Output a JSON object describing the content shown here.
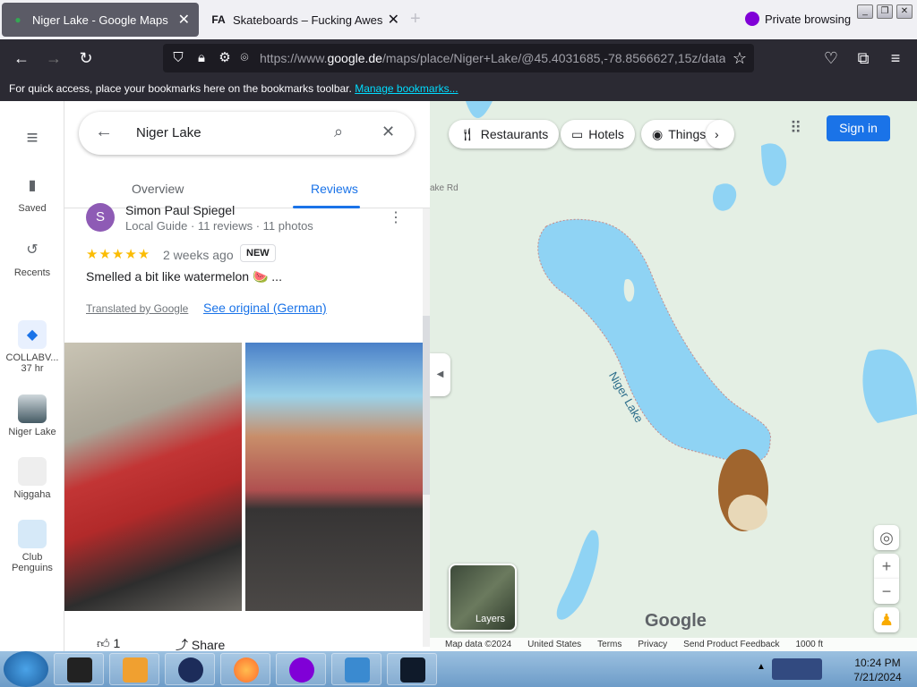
{
  "browser": {
    "tabs": [
      {
        "title": "Niger Lake - Google Maps",
        "icon": "google-maps-pin-icon"
      },
      {
        "title": "Skateboards – Fucking Awesome",
        "icon": "fa-logo-icon"
      }
    ],
    "private_label": "Private browsing",
    "url_prefix": "https://www.",
    "url_domain": "google.de",
    "url_rest": "/maps/place/Niger+Lake/@45.4031685,-78.8566627,15z/data",
    "bookmarks_text": "For quick access, place your bookmarks here on the bookmarks toolbar.",
    "bookmarks_link": "Manage bookmarks..."
  },
  "rail": {
    "saved": "Saved",
    "recents": "Recents",
    "collab": "COLLABV...",
    "collab_time": "37 hr",
    "niger": "Niger Lake",
    "niggaha": "Niggaha",
    "club": "Club Penguins"
  },
  "panel": {
    "search_value": "Niger Lake",
    "tab_overview": "Overview",
    "tab_reviews": "Reviews",
    "review": {
      "avatar_letter": "S",
      "name": "Simon Paul Spiegel",
      "meta": "Local Guide · 11 reviews · 11 photos",
      "stars": "★★★★★",
      "rating": 5,
      "date": "2 weeks ago",
      "badge": "NEW",
      "text": "Smelled a bit like watermelon 🍉 ...",
      "translated": "Translated by Google",
      "see_original": "See original (German)"
    },
    "like_count": "1",
    "share": "Share"
  },
  "map": {
    "chips": [
      "Restaurants",
      "Hotels",
      "Things"
    ],
    "sign_in": "Sign in",
    "lake_label": "Niger Lake",
    "road_label": "ake Rd",
    "layers": "Layers",
    "google": "Google",
    "footer": [
      "Map data ©2024",
      "United States",
      "Terms",
      "Privacy",
      "Send Product Feedback",
      "1000 ft"
    ],
    "water_color": "#8fd3f4"
  },
  "taskbar": {
    "time": "10:24 PM",
    "date": "7/21/2024"
  }
}
